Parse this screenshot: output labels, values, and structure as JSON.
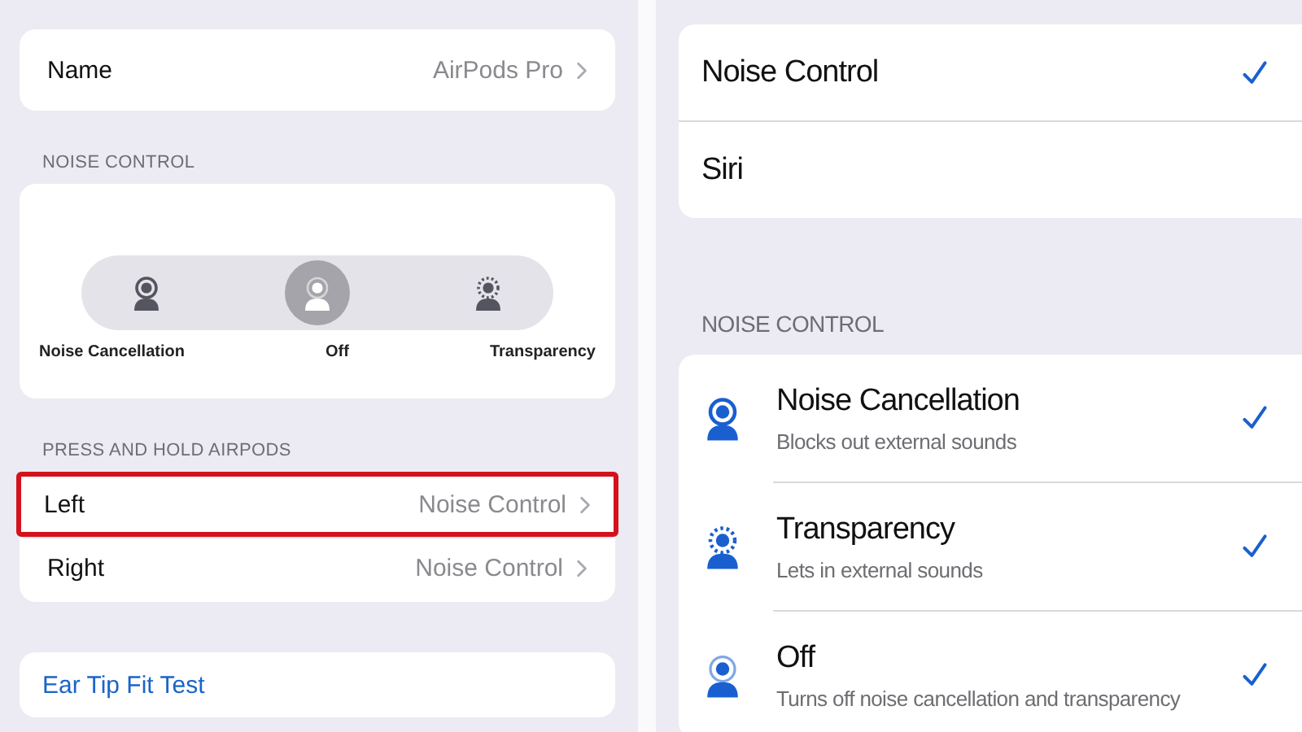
{
  "left_screen": {
    "name_row": {
      "label": "Name",
      "value": "AirPods Pro"
    },
    "noise_control": {
      "header": "NOISE CONTROL",
      "options": [
        {
          "label": "Noise Cancellation",
          "kind": "cancellation",
          "selected": false
        },
        {
          "label": "Off",
          "kind": "off",
          "selected": true
        },
        {
          "label": "Transparency",
          "kind": "transparency",
          "selected": false
        }
      ]
    },
    "press_and_hold": {
      "header": "PRESS AND HOLD AIRPODS",
      "rows": [
        {
          "label": "Left",
          "value": "Noise Control",
          "highlighted": true
        },
        {
          "label": "Right",
          "value": "Noise Control",
          "highlighted": false
        }
      ]
    },
    "ear_tip_fit_test": {
      "label": "Ear Tip Fit Test"
    }
  },
  "right_screen": {
    "press_options": [
      {
        "label": "Noise Control",
        "checked": true
      },
      {
        "label": "Siri",
        "checked": false
      }
    ],
    "noise_control": {
      "header": "NOISE CONTROL",
      "modes": [
        {
          "title": "Noise Cancellation",
          "subtitle": "Blocks out external sounds",
          "kind": "cancellation",
          "checked": true
        },
        {
          "title": "Transparency",
          "subtitle": "Lets in external sounds",
          "kind": "transparency",
          "checked": true
        },
        {
          "title": "Off",
          "subtitle": "Turns off noise cancellation and transparency",
          "kind": "off",
          "checked": true
        }
      ]
    }
  }
}
